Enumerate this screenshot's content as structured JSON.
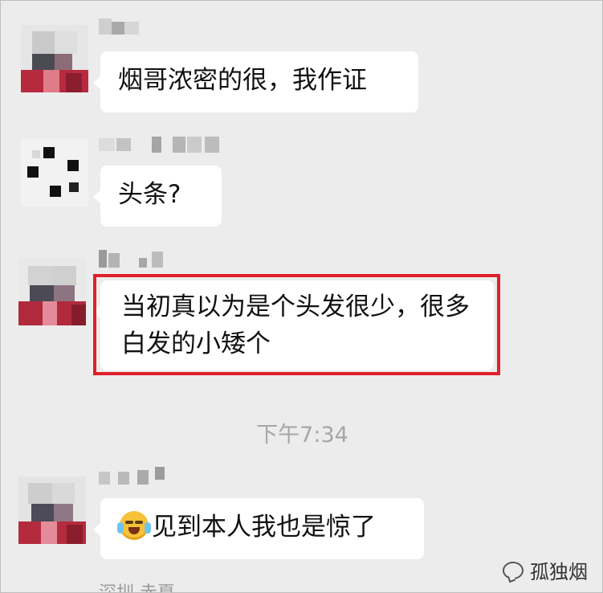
{
  "messages": [
    {
      "text": "烟哥浓密的很，我作证"
    },
    {
      "text": "头条?"
    },
    {
      "text": "当初真以为是个头发很少，很多白发的小矮个"
    },
    {
      "text": "见到本人我也是惊了",
      "emoji": "face-with-tears-of-joy-icon"
    }
  ],
  "timestamp": "下午7:34",
  "partial_nickname": "深圳 赤夏",
  "watermark": "孤独烟",
  "colors": {
    "background": "#ececec",
    "bubble": "#ffffff",
    "highlight": "#e0202a",
    "timestamp": "#a6a6a6"
  }
}
